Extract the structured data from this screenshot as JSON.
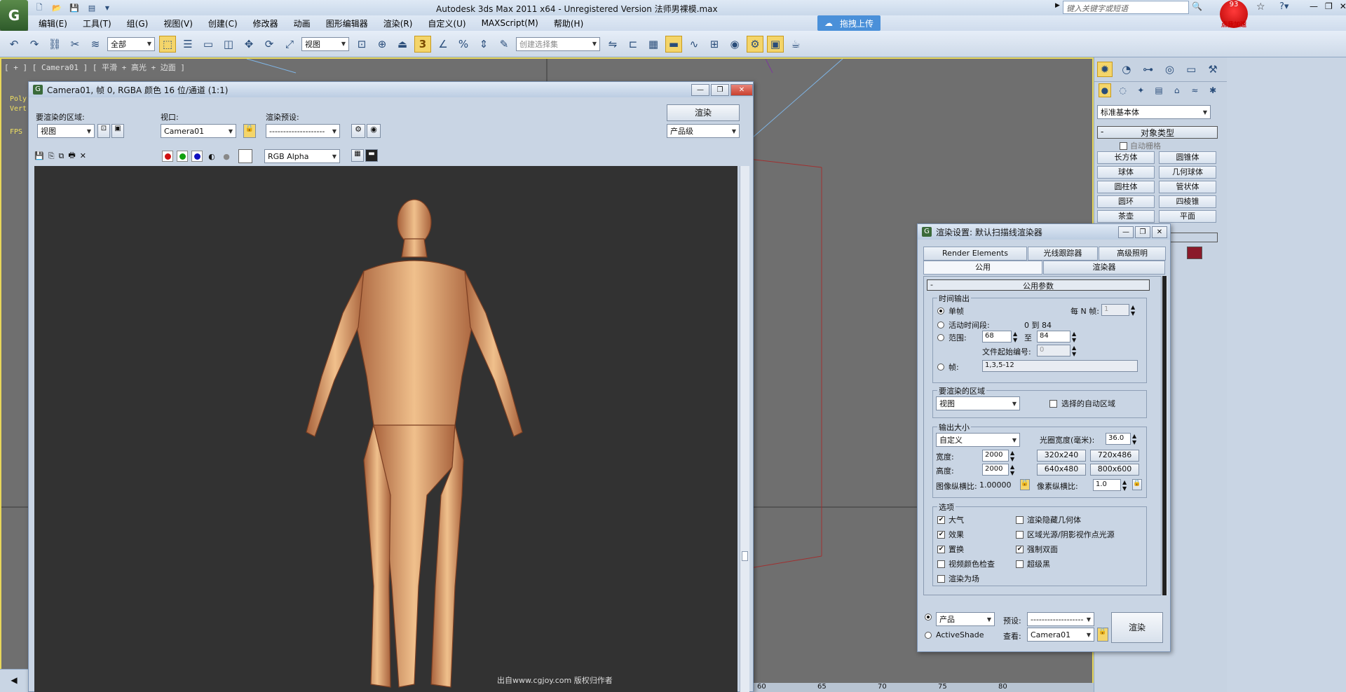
{
  "app": {
    "title": "Autodesk 3ds Max  2011 x64  - Unregistered Version   法师男裸模.max",
    "logo_letter": "G",
    "upload_btn": "拖拽上传",
    "search_placeholder": "键入关键字或短语",
    "badge_count": "93",
    "badge_label": "点我加速"
  },
  "menu": [
    "编辑(E)",
    "工具(T)",
    "组(G)",
    "视图(V)",
    "创建(C)",
    "修改器",
    "动画",
    "图形编辑器",
    "渲染(R)",
    "自定义(U)",
    "MAXScript(M)",
    "帮助(H)"
  ],
  "toolbar": {
    "filter_select": "全部",
    "coord_select": "视图",
    "snap_number": "3",
    "selection_set_placeholder": "创建选择集"
  },
  "viewport": {
    "label": "[ + ] [ Camera01 ] [ 平滑 + 高光 + 边面 ]",
    "stat_poly": "Poly",
    "stat_vert": "Vert",
    "stat_fps": "FPS",
    "ruler_ticks": [
      "60",
      "65",
      "70",
      "75",
      "80"
    ],
    "watermark": "出自www.cgjoy.com 版权归作者"
  },
  "command_panel": {
    "category": "标准基本体",
    "rollout_title": "对象类型",
    "autogrid": "自动栅格",
    "buttons": [
      "长方体",
      "圆锥体",
      "球体",
      "几何球体",
      "圆柱体",
      "管状体",
      "圆环",
      "四棱锥",
      "茶壶",
      "平面"
    ],
    "swatch_color": "#8a1a2a"
  },
  "frame_window": {
    "title": "Camera01, 帧 0, RGBA 颜色 16 位/通道 (1:1)",
    "area_label": "要渲染的区域:",
    "area_value": "视图",
    "viewport_label": "视口:",
    "viewport_value": "Camera01",
    "preset_label": "渲染预设:",
    "preset_value": "--------------------",
    "render_btn": "渲染",
    "quality_value": "产品级",
    "channel_value": "RGB Alpha"
  },
  "render_settings": {
    "title": "渲染设置: 默认扫描线渲染器",
    "tabs_row1": [
      "Render Elements",
      "光线跟踪器",
      "高级照明"
    ],
    "tabs_row2": [
      "公用",
      "渲染器"
    ],
    "rollout": "公用参数",
    "time_output": {
      "label": "时间输出",
      "single": "单帧",
      "every_n_label": "每 N 帧:",
      "every_n_value": "1",
      "active_segment": "活动时间段:",
      "active_range": "0 到 84",
      "range_label": "范围:",
      "range_from": "68",
      "range_to_label": "至",
      "range_to": "84",
      "file_start_label": "文件起始编号:",
      "file_start_value": "0",
      "frames_label": "帧:",
      "frames_value": "1,3,5-12"
    },
    "area": {
      "label": "要渲染的区域",
      "value": "视图",
      "auto_region": "选择的自动区域"
    },
    "output_size": {
      "label": "输出大小",
      "preset": "自定义",
      "aperture_label": "光圈宽度(毫米):",
      "aperture_value": "36.0",
      "width_label": "宽度:",
      "width_value": "2000",
      "height_label": "高度:",
      "height_value": "2000",
      "presets": [
        "320x240",
        "720x486",
        "640x480",
        "800x600"
      ],
      "aspect_label": "图像纵横比:",
      "aspect_value": "1.00000",
      "pixel_aspect_label": "像素纵横比:",
      "pixel_aspect_value": "1.0"
    },
    "options": {
      "label": "选项",
      "items": [
        {
          "label": "大气",
          "checked": true
        },
        {
          "label": "渲染隐藏几何体",
          "checked": false
        },
        {
          "label": "效果",
          "checked": true
        },
        {
          "label": "区域光源/阴影视作点光源",
          "checked": false
        },
        {
          "label": "置换",
          "checked": true
        },
        {
          "label": "强制双面",
          "checked": true
        },
        {
          "label": "视频颜色检查",
          "checked": false
        },
        {
          "label": "超级黑",
          "checked": false
        },
        {
          "label": "渲染为场",
          "checked": false
        }
      ]
    },
    "footer": {
      "mode1": "产品",
      "mode2": "ActiveShade",
      "preset_label": "预设:",
      "preset_value": "-------------------",
      "view_label": "查看:",
      "view_value": "Camera01",
      "render_btn": "渲染"
    }
  }
}
